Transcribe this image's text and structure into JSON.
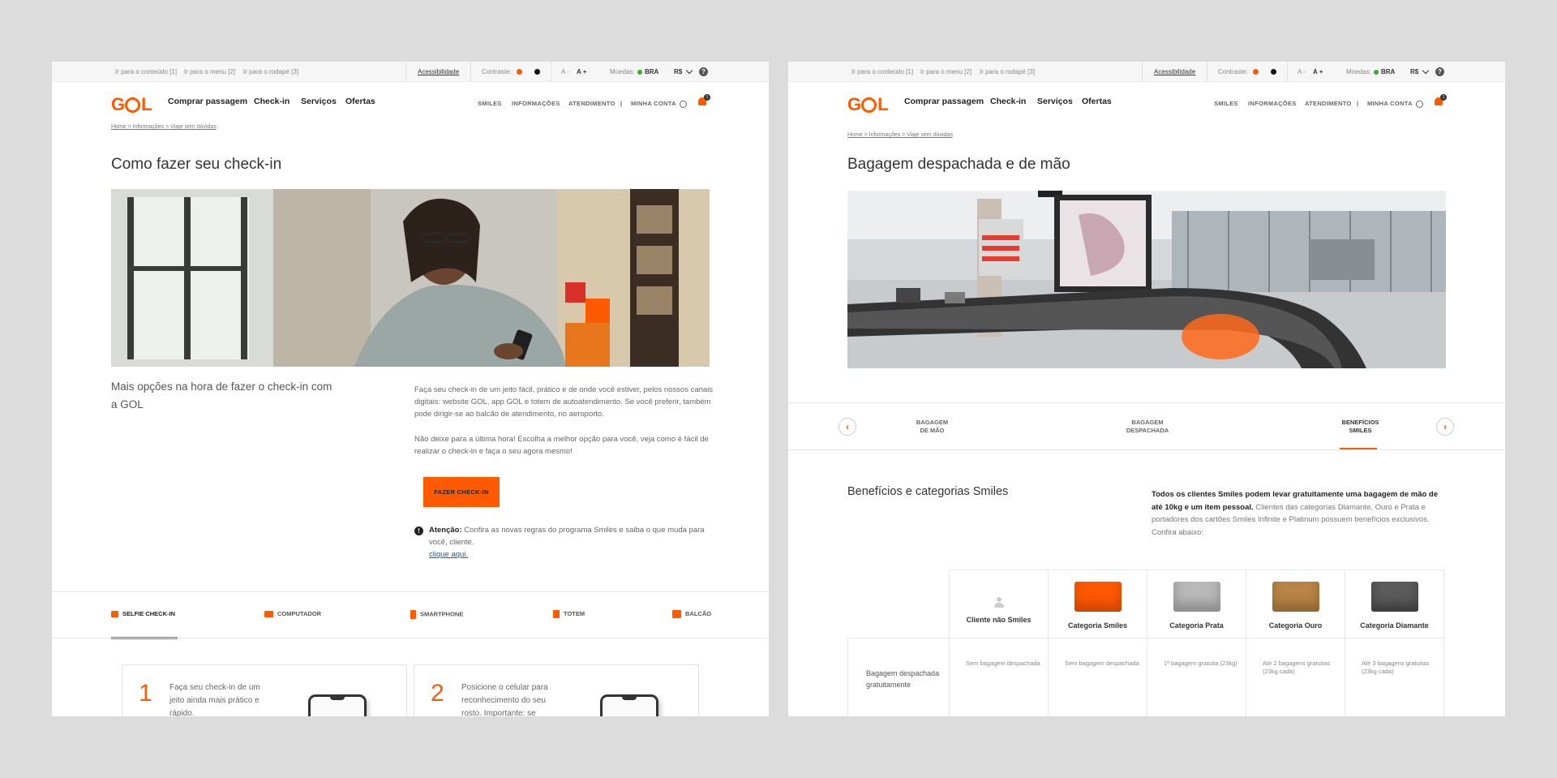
{
  "brand": {
    "logo_text": "GOL",
    "accent": "#ff5a00"
  },
  "util": {
    "skip_content": "Ir para o conteúdo [1]",
    "skip_menu": "Ir para o menu [2]",
    "skip_footer": "Ir para o rodapé [3]",
    "accessibility": "Acessibilidade",
    "contrast_label": "Contraste:",
    "font_minus": "A -",
    "font_plus": "A +",
    "currency_label": "Moedas:",
    "country": "BRA",
    "currency": "R$",
    "help": "?"
  },
  "nav": {
    "main": [
      "Comprar passagem",
      "Check-in",
      "Serviços",
      "Ofertas"
    ],
    "right": [
      "SMILES",
      "INFORMAÇÕES",
      "ATENDIMENTO",
      "|",
      "MINHA CONTA"
    ],
    "notif_count": "1"
  },
  "left": {
    "breadcrumb": "Home  >  Informações > Viaje sem dúvidas",
    "title": "Como fazer seu check-in",
    "subtitle": "Mais opções na hora de fazer o check-in com a GOL",
    "para1": "Faça seu check-in de um jeito fácil, prático e de onde você estiver, pelos nossos canais digitais: website GOL, app GOL e totem de autoatendimento. Se você preferir, também pode dirigir-se ao balcão de atendimento, no aeroporto.",
    "para2": "Não deixe para a última hora! Escolha a melhor opção para você, veja como é fácil de realizar o check-in e faça o seu agora mesmo!",
    "cta": "FAZER CHECK-IN",
    "warn_label": "Atenção:",
    "warn_text": " Confira as novas regras do programa Smiles e saiba o que muda para você, cliente.",
    "warn_link": "clique aqui.",
    "tabs": [
      "SELFIE CHECK-IN",
      "COMPUTADOR",
      "SMARTPHONE",
      "TOTEM",
      "BALCÃO"
    ],
    "steps": [
      {
        "num": "1",
        "text": "Faça seu check-in de um jeito ainda mais prático e rápido."
      },
      {
        "num": "2",
        "text": "Posicione o celular para reconhecimento do seu rosto. Importante: se"
      }
    ]
  },
  "right": {
    "breadcrumb": "Home  > Informações > Viaje sem dúvidas",
    "title": "Bagagem despachada e de mão",
    "carousel_tabs": [
      {
        "l1": "BAGAGEM",
        "l2": "DE MÃO"
      },
      {
        "l1": "BAGAGEM",
        "l2": "DESPACHADA"
      },
      {
        "l1": "BENEFÍCIOS",
        "l2": "SMILES"
      }
    ],
    "prev": "‹",
    "next": "›",
    "section_title": "Benefícios e categorias Smiles",
    "section_bold": "Todos os clientes Smiles podem levar gratuitamente uma bagagem de mão de até 10kg e um item pessoal.",
    "section_text": " Clientes das categorias Diamante, Ouro e Prata e portadores dos cartões Smiles Infinite e Platinum possuem benefícios exclusivos. Confira abaixo:",
    "columns": [
      "Cliente não Smiles",
      "Categoria Smiles",
      "Categoria Prata",
      "Categoria Ouro",
      "Categoria Diamante"
    ],
    "row_label": "Bagagem despachada gratuitamente",
    "row_values": [
      "Sem bagagem despachada",
      "Sem bagagem despachada",
      "1ª bagagem gratuita (23kg)",
      "Até 2 bagagens gratuitas (23kg cada)",
      "Até 3 bagagens gratuitas (23kg cada)"
    ],
    "card_colors": [
      "#e8e8e8",
      "#ff5a00",
      "#b9b9b9",
      "#b88545",
      "#5c5c5c"
    ]
  }
}
